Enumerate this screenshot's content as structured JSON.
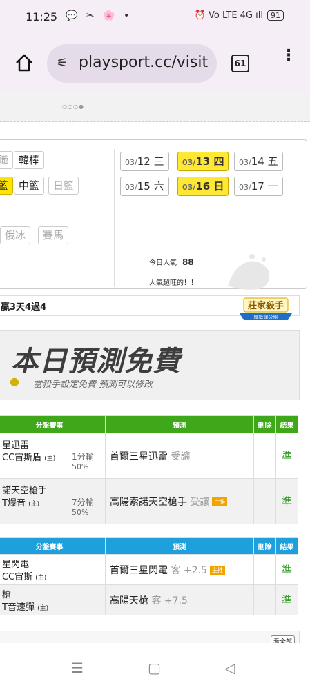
{
  "status_bar": {
    "time": "11:25",
    "left_icons": "💬 ✂ 🌸 •",
    "right_icons": "⏰ Vo LTE 4G ıll",
    "battery": "91"
  },
  "browser": {
    "url": "playsport.cc/visit",
    "tab_count": "61"
  },
  "sports": {
    "row1": [
      "韓棒"
    ],
    "row1_partial": "職",
    "row2_partial": "籃",
    "row2": [
      "中籃",
      "日籃"
    ],
    "row3": [
      "俄冰",
      "賽馬"
    ]
  },
  "dates": [
    {
      "md": "03/",
      "d": "12",
      "w": "三",
      "today": false
    },
    {
      "md": "03/",
      "d": "13",
      "w": "四",
      "today": true
    },
    {
      "md": "03/",
      "d": "14",
      "w": "五",
      "today": false
    },
    {
      "md": "03/",
      "d": "15",
      "w": "六",
      "today": false
    },
    {
      "md": "03/",
      "d": "16",
      "w": "日",
      "today": true
    },
    {
      "md": "03/",
      "d": "17",
      "w": "一",
      "today": false
    }
  ],
  "popularity": {
    "label": "今日人氣",
    "value": "88",
    "note": "人氣超旺的！！"
  },
  "record": "贏3天4過4",
  "badge": {
    "title": "莊家殺手",
    "subtitle": "韓籃讓分盤"
  },
  "banner": {
    "title": "本日預測免費",
    "subtitle": "當殺手設定免費  預測可以修改"
  },
  "table1": {
    "headers": [
      "分盤賽事",
      "預測",
      "刪除",
      "結果"
    ],
    "rows": [
      {
        "team1": "星迅雷",
        "team2": "CC宙斯盾",
        "home": "(主)",
        "odds": "1分輸",
        "pct": "50%",
        "pick": "首爾三星迅雷",
        "pick_sub": "受讓",
        "mark": "",
        "result": "準"
      },
      {
        "team1": "諾天空槍手",
        "team2": "T爆音",
        "home": "(主)",
        "odds": "7分輸",
        "pct": "50%",
        "pick": "高陽索諾天空槍手",
        "pick_sub": "受讓",
        "mark": "主推",
        "result": "準"
      }
    ]
  },
  "table2": {
    "headers": [
      "分盤賽事",
      "預測",
      "刪除",
      "結果"
    ],
    "rows": [
      {
        "team1": "星閃電",
        "team2": "CC宙斯",
        "home": "(主)",
        "pick": "首爾三星閃電",
        "pick_sub": "客 +2.5",
        "mark": "主推",
        "result": "準"
      },
      {
        "team1": "槍",
        "team2": "T音速彈",
        "home": "(主)",
        "pick": "高陽天槍",
        "pick_sub": "客 +7.5",
        "mark": "",
        "result": "準"
      }
    ]
  },
  "more_label": "看全部"
}
